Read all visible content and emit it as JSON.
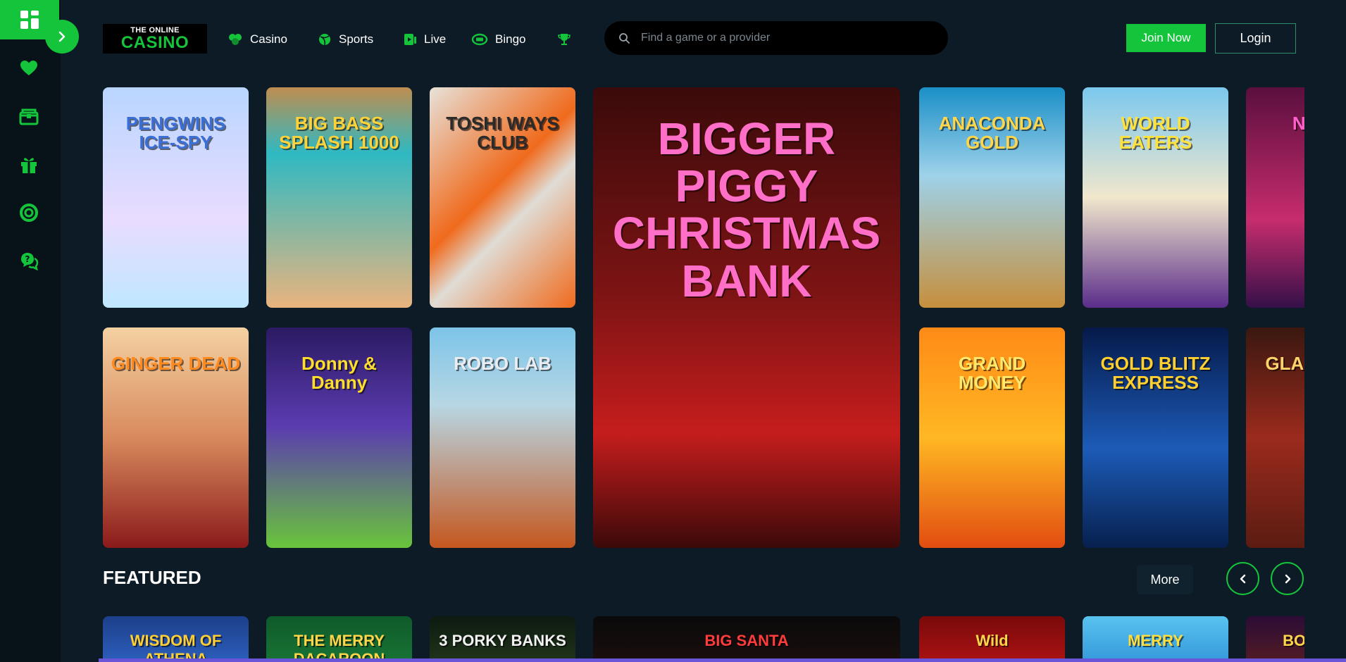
{
  "colors": {
    "accent": "#14c43b",
    "background": "#0d1b26",
    "rail": "#081219"
  },
  "logo": {
    "line1": "THE ONLINE",
    "line2": "CASINO"
  },
  "nav": [
    {
      "label": "Casino",
      "icon": "clover-icon"
    },
    {
      "label": "Sports",
      "icon": "ball-icon"
    },
    {
      "label": "Live",
      "icon": "live-card-icon"
    },
    {
      "label": "Bingo",
      "icon": "bingo-icon"
    },
    {
      "label": "",
      "icon": "trophy-icon"
    }
  ],
  "search": {
    "placeholder": "Find a game or a provider"
  },
  "auth": {
    "join": "Join Now",
    "login": "Login"
  },
  "rail_icons": [
    "heart-icon",
    "treasure-chest-icon",
    "gift-icon",
    "target-ring-icon",
    "chat-help-icon"
  ],
  "games": [
    {
      "title": "PENGWINS ICE-SPY",
      "bg": "linear-gradient(180deg,#b9d6ff,#e9dcff 60%,#bfe7ff)",
      "color": "#3b6fd8"
    },
    {
      "title": "BIG BASS SPLASH 1000",
      "bg": "linear-gradient(180deg,#bf8d4f,#2fb9c2 30%,#e9b47e)",
      "color": "#ffd23a"
    },
    {
      "title": "TOSHI WAYS CLUB",
      "bg": "linear-gradient(135deg,#e7e2da 0%,#f06a1c 45%,#e0dcd5 60%,#f06a1c)",
      "color": "#2a2a2a"
    },
    {
      "title": "BIGGER PIGGY CHRISTMAS BANK",
      "bg": "linear-gradient(180deg,#3b0a0a,#7d1414 45%,#c61d1d 75%,#3c0909)",
      "color": "#ff6ec7"
    },
    {
      "title": "ANACONDA GOLD",
      "bg": "linear-gradient(180deg,#1b8fc7,#9ed2ea 40%,#c68f3c)",
      "color": "#ffd54a"
    },
    {
      "title": "WORLD EATERS",
      "bg": "linear-gradient(180deg,#7bc8ee,#f1e7cc 50%,#5a2d8a)",
      "color": "#ffe23b"
    },
    {
      "title": "NEON",
      "bg": "linear-gradient(180deg,#5a0f3e,#c72c6d 60%,#351049)",
      "color": "#ff61c9"
    },
    {
      "title": "GINGER DEAD",
      "bg": "linear-gradient(180deg,#f4d1a2,#d88a5d 50%,#8a1a1a)",
      "color": "#ff8a1d"
    },
    {
      "title": "Donny & Danny",
      "bg": "linear-gradient(180deg,#2b1a63,#5b3cb0 45%,#69c43b)",
      "color": "#ffde2b"
    },
    {
      "title": "ROBO LAB",
      "bg": "linear-gradient(180deg,#7cc4e8,#b8d7e4 35%,#c4571f)",
      "color": "#e9edf2"
    },
    {
      "title": "GRAND MONEY",
      "bg": "linear-gradient(180deg,#ff8a17,#ffb823 50%,#e24d11)",
      "color": "#ffe86b"
    },
    {
      "title": "GOLD BLITZ EXPRESS",
      "bg": "linear-gradient(180deg,#061a4a,#1c5bb7 55%,#07204e)",
      "color": "#ffcf2f"
    },
    {
      "title": "GLADIATOR",
      "bg": "linear-gradient(180deg,#3a1810,#9b2a1d 50%,#5b1c12)",
      "color": "#ffd36b"
    }
  ],
  "featured": {
    "title": "FEATURED",
    "more": "More",
    "games": [
      {
        "title": "WISDOM OF ATHENA",
        "bg": "linear-gradient(180deg,#1d3f8a,#2f66c7)",
        "color": "#ffcf33"
      },
      {
        "title": "THE MERRY DACAROON",
        "bg": "linear-gradient(180deg,#0f5a2a,#1a7a37)",
        "color": "#ffd54a"
      },
      {
        "title": "3 PORKY BANKS",
        "bg": "linear-gradient(180deg,#0d1a10,#253a1d)",
        "color": "#f2f2f2"
      },
      {
        "title": "BIG SANTA",
        "bg": "linear-gradient(180deg,#0a0a0a,#1e0f0f)",
        "color": "#ff3b3b"
      },
      {
        "title": "Wild",
        "bg": "linear-gradient(180deg,#7a0a0a,#b51414)",
        "color": "#ffd54a"
      },
      {
        "title": "MERRY",
        "bg": "linear-gradient(180deg,#59c3ef,#2d8fd6)",
        "color": "#ffde3b"
      },
      {
        "title": "BOOK OF",
        "bg": "linear-gradient(180deg,#2c0c36,#5a1f20)",
        "color": "#ffd54a"
      }
    ]
  }
}
